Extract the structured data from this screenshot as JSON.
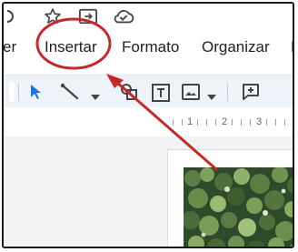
{
  "menu": {
    "items": [
      {
        "label": "er"
      },
      {
        "label": "Insertar"
      },
      {
        "label": "Formato"
      },
      {
        "label": "Organizar"
      },
      {
        "label": "H"
      }
    ]
  },
  "top_icons": [
    "star-icon",
    "move-to-folder-icon",
    "cloud-saved-icon"
  ],
  "toolbar": {
    "icons": [
      "select-cursor-icon",
      "line-icon",
      "dropdown-arrow-icon",
      "shape-icon",
      "text-box-icon",
      "image-icon",
      "dropdown-arrow-icon",
      "add-comment-icon"
    ]
  },
  "ruler": {
    "numbers": [
      "1",
      "2",
      "3"
    ]
  },
  "annotation": {
    "highlight_color": "#c62828",
    "target": "Insertar"
  },
  "colors": {
    "toolbar_bg": "#eef2f9",
    "select_accent": "#1a73e8",
    "annotation": "#c62828"
  }
}
